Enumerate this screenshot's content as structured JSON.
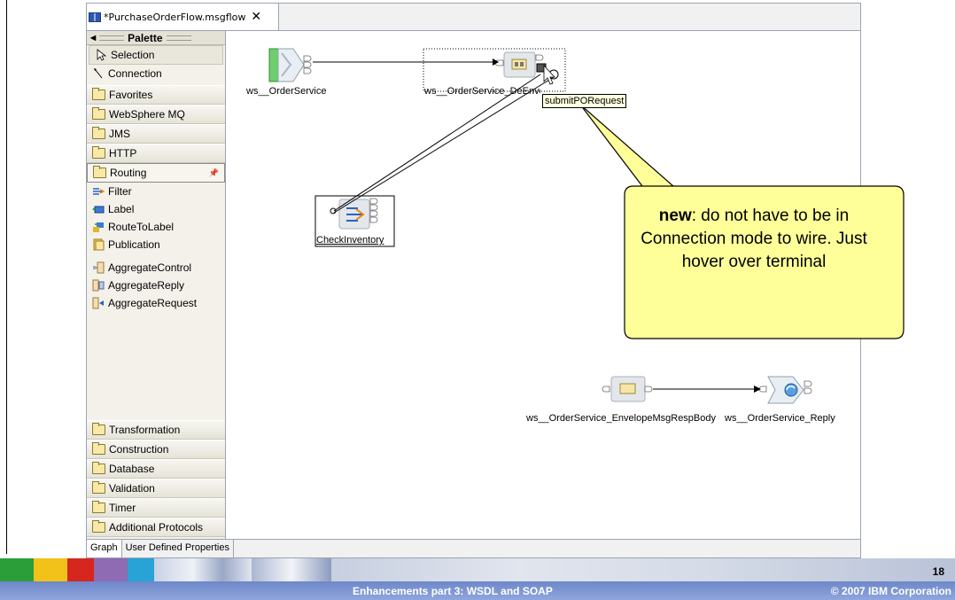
{
  "editor": {
    "tab_title": "*PurchaseOrderFlow.msgflow",
    "close_glyph": "✕"
  },
  "palette": {
    "title": "Palette",
    "tools": [
      {
        "label": "Selection",
        "icon": "arrow-pointer-icon"
      },
      {
        "label": "Connection",
        "icon": "connection-icon"
      }
    ],
    "drawers_top": [
      "Favorites",
      "WebSphere MQ",
      "JMS",
      "HTTP"
    ],
    "open_drawer": "Routing",
    "routing_items": [
      "Filter",
      "Label",
      "RouteToLabel",
      "Publication"
    ],
    "aggregate_items": [
      "AggregateControl",
      "AggregateReply",
      "AggregateRequest"
    ],
    "drawers_bottom": [
      "Transformation",
      "Construction",
      "Database",
      "Validation",
      "Timer",
      "Additional Protocols"
    ]
  },
  "canvas": {
    "nodes": {
      "input": "ws__OrderService",
      "envelope": "ws__OrderService_DeEnvelopeMsgBody",
      "check": "CheckInventory",
      "resp_envelope": "ws__OrderService_EnvelopeMsgRespBody",
      "reply": "ws__OrderService_Reply"
    },
    "tooltip": "submitPORequest"
  },
  "callout": {
    "bold": "new",
    "text": ": do not have to be in Connection mode to wire. Just hover over terminal"
  },
  "bottom_tabs": [
    "Graph",
    "User Defined Properties"
  ],
  "footer": {
    "page_number": "18",
    "title": "Enhancements part 3: WSDL and SOAP",
    "copyright": "© 2007 IBM Corporation",
    "colors": [
      "#2b9e3a",
      "#f2c21a",
      "#d7261e",
      "#8e6bb3",
      "#27a3d6"
    ]
  }
}
